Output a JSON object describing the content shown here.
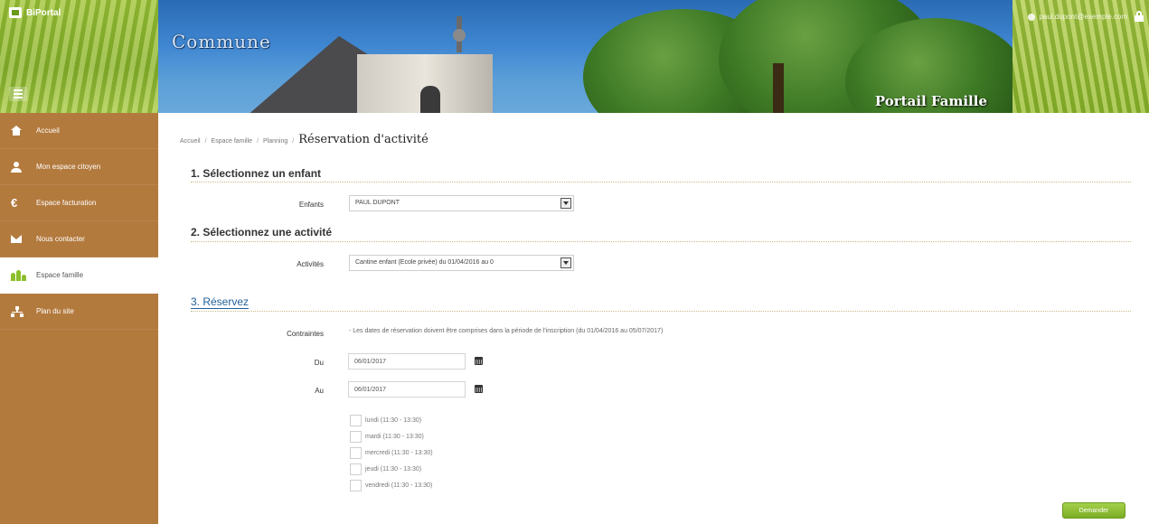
{
  "app": {
    "brand": "BiPortal"
  },
  "banner": {
    "title": "Commune",
    "subtitle": "Portail Famille",
    "user_email": "paul.dupont@exemple.com"
  },
  "sidebar": {
    "items": [
      {
        "label": "Accueil",
        "icon": "home-icon"
      },
      {
        "label": "Mon espace citoyen",
        "icon": "user-icon"
      },
      {
        "label": "Espace facturation",
        "icon": "euro-icon"
      },
      {
        "label": "Nous contacter",
        "icon": "mail-icon"
      },
      {
        "label": "Espace famille",
        "icon": "family-icon",
        "active": true
      },
      {
        "label": "Plan du site",
        "icon": "sitemap-icon"
      }
    ]
  },
  "breadcrumb": {
    "items": [
      "Accueil",
      "Espace famille",
      "Planning"
    ],
    "current": "Réservation d'activité"
  },
  "step1": {
    "title": "1. Sélectionnez un enfant",
    "label": "Enfants",
    "value": "PAUL DUPONT"
  },
  "step2": {
    "title": "2. Sélectionnez une activité",
    "label": "Activités",
    "value": "Cantine enfant (Ecole privée) du 01/04/2016 au 0"
  },
  "step3": {
    "title": "3. Réservez",
    "constraint_label": "Contraintes",
    "constraint_text": "- Les dates de réservation doivent être comprises dans la période de l'inscription (du 01/04/2016 au 05/07/2017)",
    "from_label": "Du",
    "from_value": "06/01/2017",
    "to_label": "Au",
    "to_value": "06/01/2017",
    "days": [
      "lundi (11:30 - 13:30)",
      "mardi (11:30 - 13:30)",
      "mercredi (11:30 - 13:30)",
      "jeudi (11:30 - 13:30)",
      "vendredi (11:30 - 13:30)"
    ]
  },
  "actions": {
    "submit_label": "Demander"
  },
  "colors": {
    "sidebar": "#b37a3e",
    "accent_green": "#8cbf2a",
    "section_blue": "#1f5f99"
  }
}
